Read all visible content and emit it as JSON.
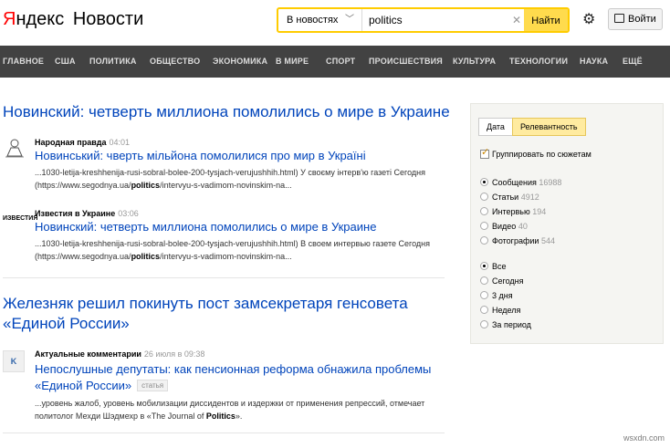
{
  "header": {
    "logo_brand": "Яндекс",
    "logo_section": "Новости",
    "search_scope": "В новостях",
    "search_value": "politics",
    "search_button": "Найти",
    "login_button": "Войти"
  },
  "nav": [
    "ГЛАВНОЕ",
    "США",
    "ПОЛИТИКА",
    "ОБЩЕСТВО",
    "ЭКОНОМИКА",
    "В МИРЕ",
    "СПОРТ",
    "ПРОИСШЕСТВИЯ",
    "КУЛЬТУРА",
    "ТЕХНОЛОГИИ",
    "НАУКА",
    "ЕЩЁ"
  ],
  "stories": [
    {
      "title": "Новинский: четверть миллиона помолились о мире в Украине",
      "items": [
        {
          "source": "Народная правда",
          "time": "04:01",
          "headline": "Новинський: чверть мільйона помолилися про мир в Україні",
          "snippet_a": "...1030-letija-kreshhenija-rusi-sobral-bolee-200-tysjach-verujushhih.html) У своєму інтерв'ю газеті Сегодня (https://www.segodnya.ua/",
          "snippet_hl": "politics",
          "snippet_b": "/intervyu-s-vadimom-novinskim-na..."
        },
        {
          "source": "Известия в Украине",
          "time": "03:06",
          "headline": "Новинский: четверть миллиона помолились о мире в Украине",
          "snippet_a": "...1030-letija-kreshhenija-rusi-sobral-bolee-200-tysjach-verujushhih.html) В своем интервью газете Сегодня (https://www.segodnya.ua/",
          "snippet_hl": "politics",
          "snippet_b": "/intervyu-s-vadimom-novinskim-na..."
        }
      ]
    },
    {
      "title": "Железняк решил покинуть пост замсекретаря генсовета «Единой России»",
      "items": [
        {
          "source": "Актуальные комментарии",
          "time": "26 июля в 09:38",
          "headline": "Непослушные депутаты: как пенсионная реформа обнажила проблемы «Единой России»",
          "tag": "статья",
          "snippet_a": "...уровень жалоб, уровень мобилизации диссидентов и издержки от применения репрессий, отмечает политолог Мехди Шэдмехр в «The Journal of ",
          "snippet_hl": "Politics",
          "snippet_b": "»."
        }
      ]
    }
  ],
  "sidebar": {
    "tabs": [
      "Дата",
      "Релевантность"
    ],
    "group_label": "Группировать по сюжетам",
    "types": [
      {
        "label": "Сообщения",
        "count": "16988"
      },
      {
        "label": "Статьи",
        "count": "4912"
      },
      {
        "label": "Интервью",
        "count": "194"
      },
      {
        "label": "Видео",
        "count": "40"
      },
      {
        "label": "Фотографии",
        "count": "544"
      }
    ],
    "periods": [
      "Все",
      "Сегодня",
      "3 дня",
      "Неделя",
      "За период"
    ]
  },
  "watermark": "wsxdn.com",
  "source_logos": {
    "izvestia": "ИЗВЕСТИЯ",
    "aktualnye": "K"
  }
}
